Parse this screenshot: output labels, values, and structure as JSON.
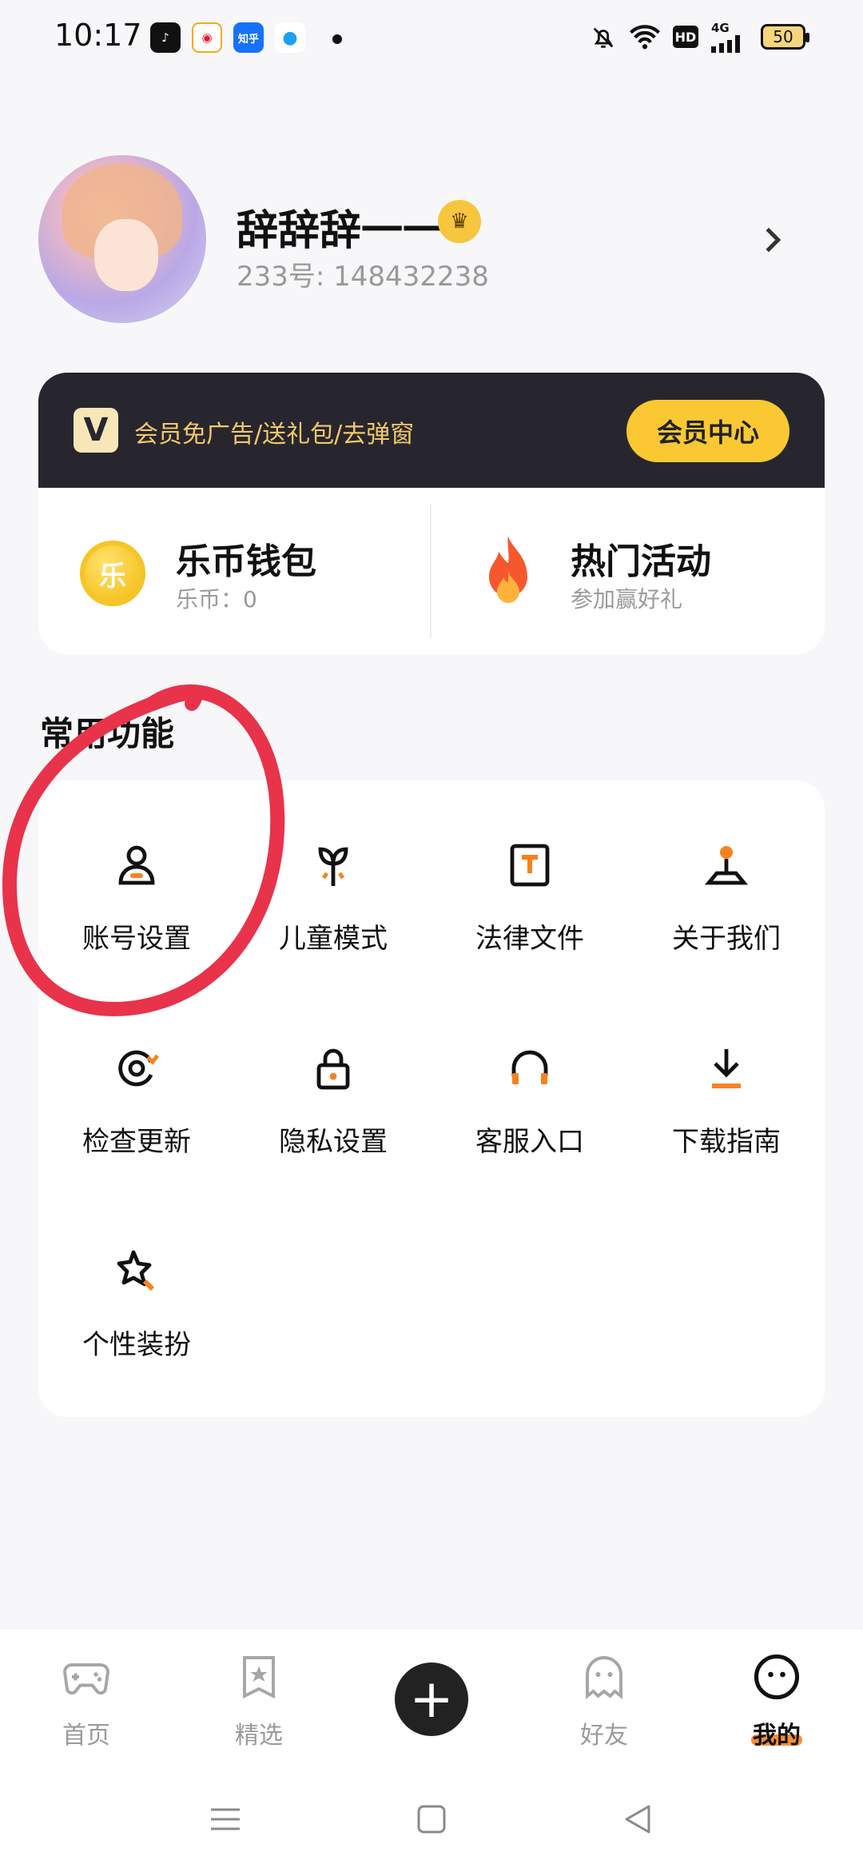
{
  "status_bar": {
    "time": "10:17",
    "apps": [
      {
        "name": "tiktok-icon",
        "label": "♪",
        "color": "#111111"
      },
      {
        "name": "weibo-icon",
        "label": "◉",
        "color": "#f7a91b"
      },
      {
        "name": "zhihu-icon",
        "label": "知乎",
        "color": "#1772f6"
      },
      {
        "name": "browser-icon",
        "label": "●",
        "color": "#1ba0f2"
      }
    ],
    "network_label": "4G",
    "hd_label": "HD",
    "battery": "50"
  },
  "profile": {
    "name": "辞辞辞一一",
    "id_text": "233号: 148432238"
  },
  "vip": {
    "logo": "V",
    "promo": "会员免广告/送礼包/去弹窗",
    "button": "会员中心"
  },
  "wallet": {
    "coin_glyph": "乐",
    "title": "乐币钱包",
    "sub": "乐币：0"
  },
  "hot": {
    "title": "热门活动",
    "sub": "参加赢好礼"
  },
  "functions": {
    "title": "常用功能",
    "items": [
      {
        "label": "账号设置",
        "icon": "user-icon"
      },
      {
        "label": "儿童模式",
        "icon": "sprout-icon"
      },
      {
        "label": "法律文件",
        "icon": "document-icon"
      },
      {
        "label": "关于我们",
        "icon": "pin-icon"
      },
      {
        "label": "检查更新",
        "icon": "refresh-icon"
      },
      {
        "label": "隐私设置",
        "icon": "lock-icon"
      },
      {
        "label": "客服入口",
        "icon": "headset-icon"
      },
      {
        "label": "下载指南",
        "icon": "download-icon"
      },
      {
        "label": "个性装扮",
        "icon": "star-wand-icon"
      }
    ]
  },
  "nav": {
    "items": [
      {
        "label": "首页",
        "icon": "gamepad-icon"
      },
      {
        "label": "精选",
        "icon": "star-bookmark-icon"
      },
      {
        "label": "好友",
        "icon": "ghost-icon"
      },
      {
        "label": "我的",
        "icon": "face-icon"
      }
    ]
  },
  "colors": {
    "accent": "#f6821f",
    "vip_yellow": "#f9c832",
    "annotation_red": "#e8334a"
  }
}
